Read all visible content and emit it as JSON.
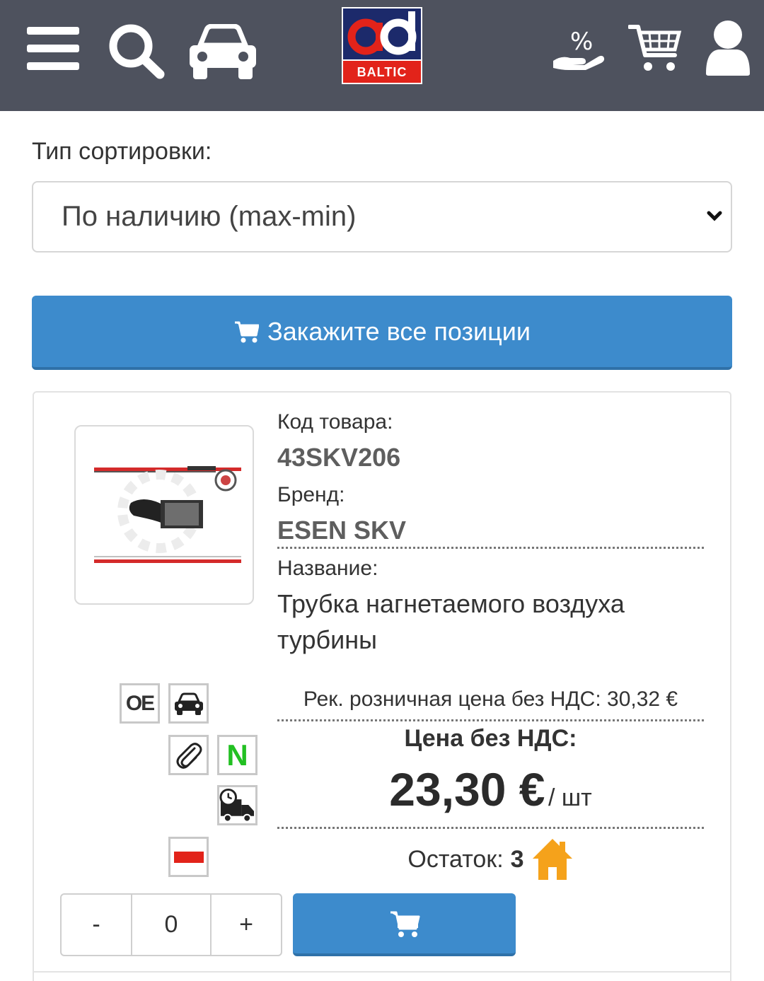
{
  "header": {
    "logo": {
      "brand_mark": "ad",
      "subtitle": "BALTIC"
    }
  },
  "sort": {
    "label": "Тип сортировки:",
    "selected": "По наличию (max-min)"
  },
  "order_all": {
    "label": "Закажите все позиции"
  },
  "product": {
    "code_label": "Код товара:",
    "code": "43SKV206",
    "brand_label": "Бренд:",
    "brand": "ESEN SKV",
    "name_label": "Название:",
    "name": "Трубка нагнетаемого воздуха турбины",
    "badges": {
      "oe": "OE",
      "new": "N"
    },
    "rrp": "Рек. розничная цена без НДС: 30,32 €",
    "price_label": "Цена без НДС:",
    "price": "23,30 €",
    "price_unit": "/ шт",
    "stock_label": "Остаток:",
    "stock": "3",
    "quantity": "0",
    "minus": "-",
    "plus": "+"
  },
  "colors": {
    "header_bg": "#4e525e",
    "accent_blue": "#3d8bcc",
    "home_orange": "#f5a21b",
    "badge_green": "#22c022",
    "badge_red": "#e2231a"
  },
  "icons": [
    "menu-icon",
    "search-icon",
    "car-icon",
    "discount-icon",
    "cart-icon",
    "user-icon",
    "chevron-down-icon",
    "paperclip-icon",
    "delivery-truck-icon",
    "home-icon"
  ]
}
